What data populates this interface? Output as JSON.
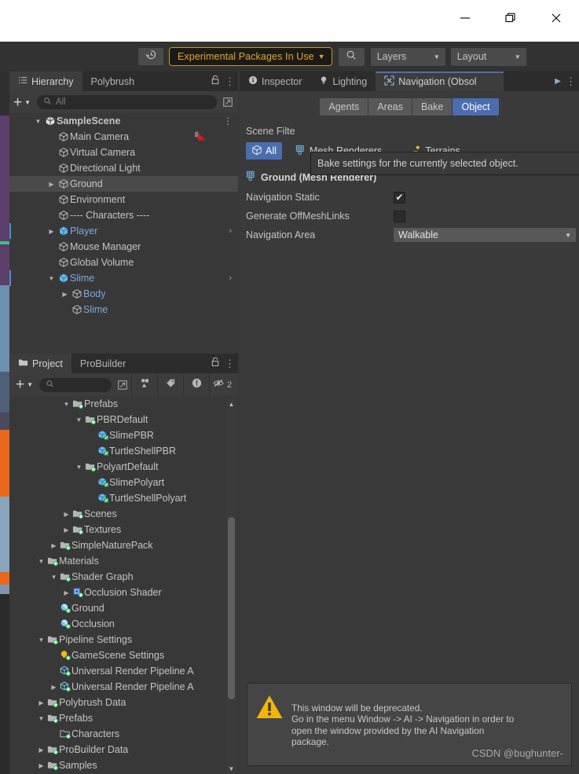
{
  "window": {
    "minimize_label": "minimize",
    "maximize_label": "maximize",
    "close_label": "close"
  },
  "toolbar": {
    "history_icon": "history-icon",
    "experimental_label": "Experimental Packages In Use",
    "experimental_caret": "▼",
    "search_icon": "search-icon",
    "layers_label": "Layers",
    "layout_label": "Layout",
    "caret": "▼",
    "accent_orange": "#e2a82b",
    "accent_blue": "#4b6daf"
  },
  "hierarchy": {
    "tabs": [
      {
        "label": "Hierarchy",
        "icon": "hierarchy-icon",
        "active": true
      },
      {
        "label": "Polybrush",
        "icon": "",
        "active": false
      }
    ],
    "lock_icon": "lock-icon",
    "menu_icon": "kebab-menu-icon",
    "add_label": "+",
    "add_caret": "▼",
    "search_placeholder": "All",
    "search_value": "",
    "search_icon": "search-icon",
    "expand_icon": "expand-icon",
    "rows": [
      {
        "label": "SampleScene",
        "depth": 0,
        "icon": "scene-icon",
        "twisty": "▼",
        "selected": false,
        "prefab": false,
        "menu": true,
        "bar": false
      },
      {
        "label": "Main Camera",
        "depth": 1,
        "icon": "gameobject-icon",
        "twisty": "",
        "selected": false,
        "prefab": false,
        "badge": "camera-audio-icon",
        "bar": false
      },
      {
        "label": "Virtual Camera",
        "depth": 1,
        "icon": "gameobject-icon",
        "twisty": "",
        "selected": false,
        "prefab": false,
        "bar": false
      },
      {
        "label": "Directional Light",
        "depth": 1,
        "icon": "gameobject-icon",
        "twisty": "",
        "selected": false,
        "prefab": false,
        "bar": false
      },
      {
        "label": "Ground",
        "depth": 1,
        "icon": "gameobject-icon",
        "twisty": "▶",
        "selected": true,
        "prefab": false,
        "bar": false
      },
      {
        "label": "Environment",
        "depth": 1,
        "icon": "gameobject-icon",
        "twisty": "",
        "selected": false,
        "prefab": false,
        "bar": false
      },
      {
        "label": "---- Characters ----",
        "depth": 1,
        "icon": "gameobject-icon",
        "twisty": "",
        "selected": false,
        "prefab": false,
        "bar": false
      },
      {
        "label": "Player",
        "depth": 1,
        "icon": "prefab-icon",
        "twisty": "▶",
        "selected": false,
        "prefab": true,
        "chevron": "›",
        "bar": true
      },
      {
        "label": "Mouse Manager",
        "depth": 1,
        "icon": "gameobject-icon",
        "twisty": "",
        "selected": false,
        "prefab": false,
        "bar": false
      },
      {
        "label": "Global Volume",
        "depth": 1,
        "icon": "gameobject-icon",
        "twisty": "",
        "selected": false,
        "prefab": false,
        "bar": false
      },
      {
        "label": "Slime",
        "depth": 1,
        "icon": "prefab-icon",
        "twisty": "▼",
        "selected": false,
        "prefab": true,
        "chevron": "›",
        "bar": true
      },
      {
        "label": "Body",
        "depth": 2,
        "icon": "gameobject-icon",
        "twisty": "▶",
        "selected": false,
        "prefab": true,
        "bar": false
      },
      {
        "label": "Slime",
        "depth": 2,
        "icon": "gameobject-icon",
        "twisty": "",
        "selected": false,
        "prefab": true,
        "bar": false
      }
    ]
  },
  "project": {
    "tabs": [
      {
        "label": "Project",
        "icon": "folder-icon",
        "active": true
      },
      {
        "label": "ProBuilder",
        "icon": "",
        "active": false
      }
    ],
    "lock_icon": "lock-icon",
    "menu_icon": "kebab-menu-icon",
    "add_label": "+",
    "add_caret": "▼",
    "search_value": "",
    "search_icon": "search-icon",
    "expand_icon": "expand-icon",
    "filter_icons": [
      "type-filter-icon",
      "label-filter-icon",
      "warning-filter-icon",
      "hidden-filter-icon"
    ],
    "hidden_count": "2",
    "rows": [
      {
        "label": "Prefabs",
        "depth": 3,
        "icon": "folder-asset-icon",
        "twisty": "▼"
      },
      {
        "label": "PBRDefault",
        "depth": 4,
        "icon": "folder-asset-icon",
        "twisty": "▼"
      },
      {
        "label": "SlimePBR",
        "depth": 5,
        "icon": "prefab-asset-icon",
        "twisty": ""
      },
      {
        "label": "TurtleShellPBR",
        "depth": 5,
        "icon": "prefab-asset-icon",
        "twisty": ""
      },
      {
        "label": "PolyartDefault",
        "depth": 4,
        "icon": "folder-asset-icon",
        "twisty": "▼"
      },
      {
        "label": "SlimePolyart",
        "depth": 5,
        "icon": "prefab-asset-icon",
        "twisty": ""
      },
      {
        "label": "TurtleShellPolyart",
        "depth": 5,
        "icon": "prefab-asset-icon",
        "twisty": ""
      },
      {
        "label": "Scenes",
        "depth": 3,
        "icon": "folder-asset-icon",
        "twisty": "▶"
      },
      {
        "label": "Textures",
        "depth": 3,
        "icon": "folder-asset-icon",
        "twisty": "▶"
      },
      {
        "label": "SimpleNaturePack",
        "depth": 2,
        "icon": "folder-asset-icon",
        "twisty": "▶"
      },
      {
        "label": "Materials",
        "depth": 1,
        "icon": "folder-asset-icon",
        "twisty": "▼"
      },
      {
        "label": "Shader Graph",
        "depth": 2,
        "icon": "folder-asset-icon",
        "twisty": "▼"
      },
      {
        "label": "Occlusion Shader",
        "depth": 3,
        "icon": "shader-asset-icon",
        "twisty": "▶"
      },
      {
        "label": "Ground",
        "depth": 2,
        "icon": "material-asset-icon",
        "twisty": ""
      },
      {
        "label": "Occlusion",
        "depth": 2,
        "icon": "material-asset-icon",
        "twisty": ""
      },
      {
        "label": "Pipeline Settings",
        "depth": 1,
        "icon": "folder-asset-icon",
        "twisty": "▼"
      },
      {
        "label": "GameScene Settings",
        "depth": 2,
        "icon": "lightsettings-asset-icon",
        "twisty": ""
      },
      {
        "label": "Universal Render Pipeline A",
        "depth": 2,
        "icon": "scriptableobject-asset-icon",
        "twisty": ""
      },
      {
        "label": "Universal Render Pipeline A",
        "depth": 2,
        "icon": "scriptableobject-asset-icon",
        "twisty": "▶"
      },
      {
        "label": "Polybrush Data",
        "depth": 1,
        "icon": "folder-asset-icon",
        "twisty": "▶"
      },
      {
        "label": "Prefabs",
        "depth": 1,
        "icon": "folder-asset-icon",
        "twisty": "▼"
      },
      {
        "label": "Characters",
        "depth": 2,
        "icon": "folder-empty-asset-icon",
        "twisty": ""
      },
      {
        "label": "ProBuilder Data",
        "depth": 1,
        "icon": "folder-asset-icon",
        "twisty": "▶"
      },
      {
        "label": "Samples",
        "depth": 1,
        "icon": "folder-asset-icon",
        "twisty": "▶"
      }
    ],
    "scroll_up_arrow": "▲",
    "scroll_down_arrow": "▼"
  },
  "navigation": {
    "tabs": [
      {
        "label": "Inspector",
        "icon": "info-icon",
        "active": false
      },
      {
        "label": "Lighting",
        "icon": "light-icon",
        "active": false
      },
      {
        "label": "Navigation (Obsol",
        "icon": "navigation-icon",
        "active": true
      }
    ],
    "overflow_icon": "chevron-right-icon",
    "menu_icon": "kebab-menu-icon",
    "modes": [
      {
        "label": "Agents",
        "active": false
      },
      {
        "label": "Areas",
        "active": false
      },
      {
        "label": "Bake",
        "active": false
      },
      {
        "label": "Object",
        "active": true
      }
    ],
    "scene_filter_label": "Scene Filte",
    "tooltip": "Bake settings for the currently selected object.",
    "filters": [
      {
        "label": "All",
        "icon": "cube-icon",
        "active": true
      },
      {
        "label": "Mesh Renderers",
        "icon": "mesh-renderer-icon",
        "active": false
      },
      {
        "label": "Terrains",
        "icon": "terrain-icon",
        "active": false
      }
    ],
    "object_header": "Ground (Mesh Renderer)",
    "object_header_icon": "mesh-renderer-icon",
    "properties": [
      {
        "name": "Navigation Static",
        "type": "checkbox",
        "value": true
      },
      {
        "name": "Generate OffMeshLinks",
        "type": "checkbox",
        "value": false
      },
      {
        "name": "Navigation Area",
        "type": "enum",
        "value": "Walkable",
        "caret": "▼"
      }
    ],
    "warning": {
      "icon": "warning-triangle-icon",
      "text": "This window will be deprecated.\nGo in the menu Window -> AI -> Navigation in order to\nopen the window provided by the AI Navigation\npackage.",
      "watermark": "CSDN @bughunter-"
    }
  }
}
